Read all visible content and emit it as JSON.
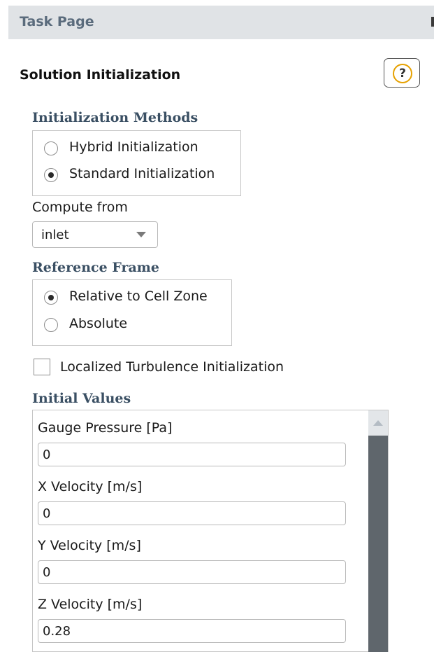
{
  "task_page": {
    "title": "Task Page"
  },
  "panel": {
    "title": "Solution Initialization",
    "help_icon": "question-mark-icon",
    "help_glyph": "?"
  },
  "init_methods": {
    "title": "Initialization Methods",
    "options": [
      {
        "label": "Hybrid  Initialization",
        "selected": false
      },
      {
        "label": "Standard Initialization",
        "selected": true
      }
    ]
  },
  "compute_from": {
    "label": "Compute from",
    "value": "inlet"
  },
  "reference_frame": {
    "title": "Reference Frame",
    "options": [
      {
        "label": "Relative to Cell Zone",
        "selected": true
      },
      {
        "label": "Absolute",
        "selected": false
      }
    ]
  },
  "localized_turbulence": {
    "label": "Localized Turbulence Initialization",
    "checked": false
  },
  "initial_values": {
    "title": "Initial Values",
    "fields": [
      {
        "label": "Gauge Pressure [Pa]",
        "value": "0"
      },
      {
        "label": "X Velocity [m/s]",
        "value": "0"
      },
      {
        "label": "Y Velocity [m/s]",
        "value": "0"
      },
      {
        "label": "Z Velocity [m/s]",
        "value": "0.28"
      }
    ]
  },
  "colors": {
    "header_bg": "#e0e3e6",
    "group_title": "#3a4f63",
    "help_ring": "#e6a100",
    "scrollbar": "#5f666c"
  }
}
